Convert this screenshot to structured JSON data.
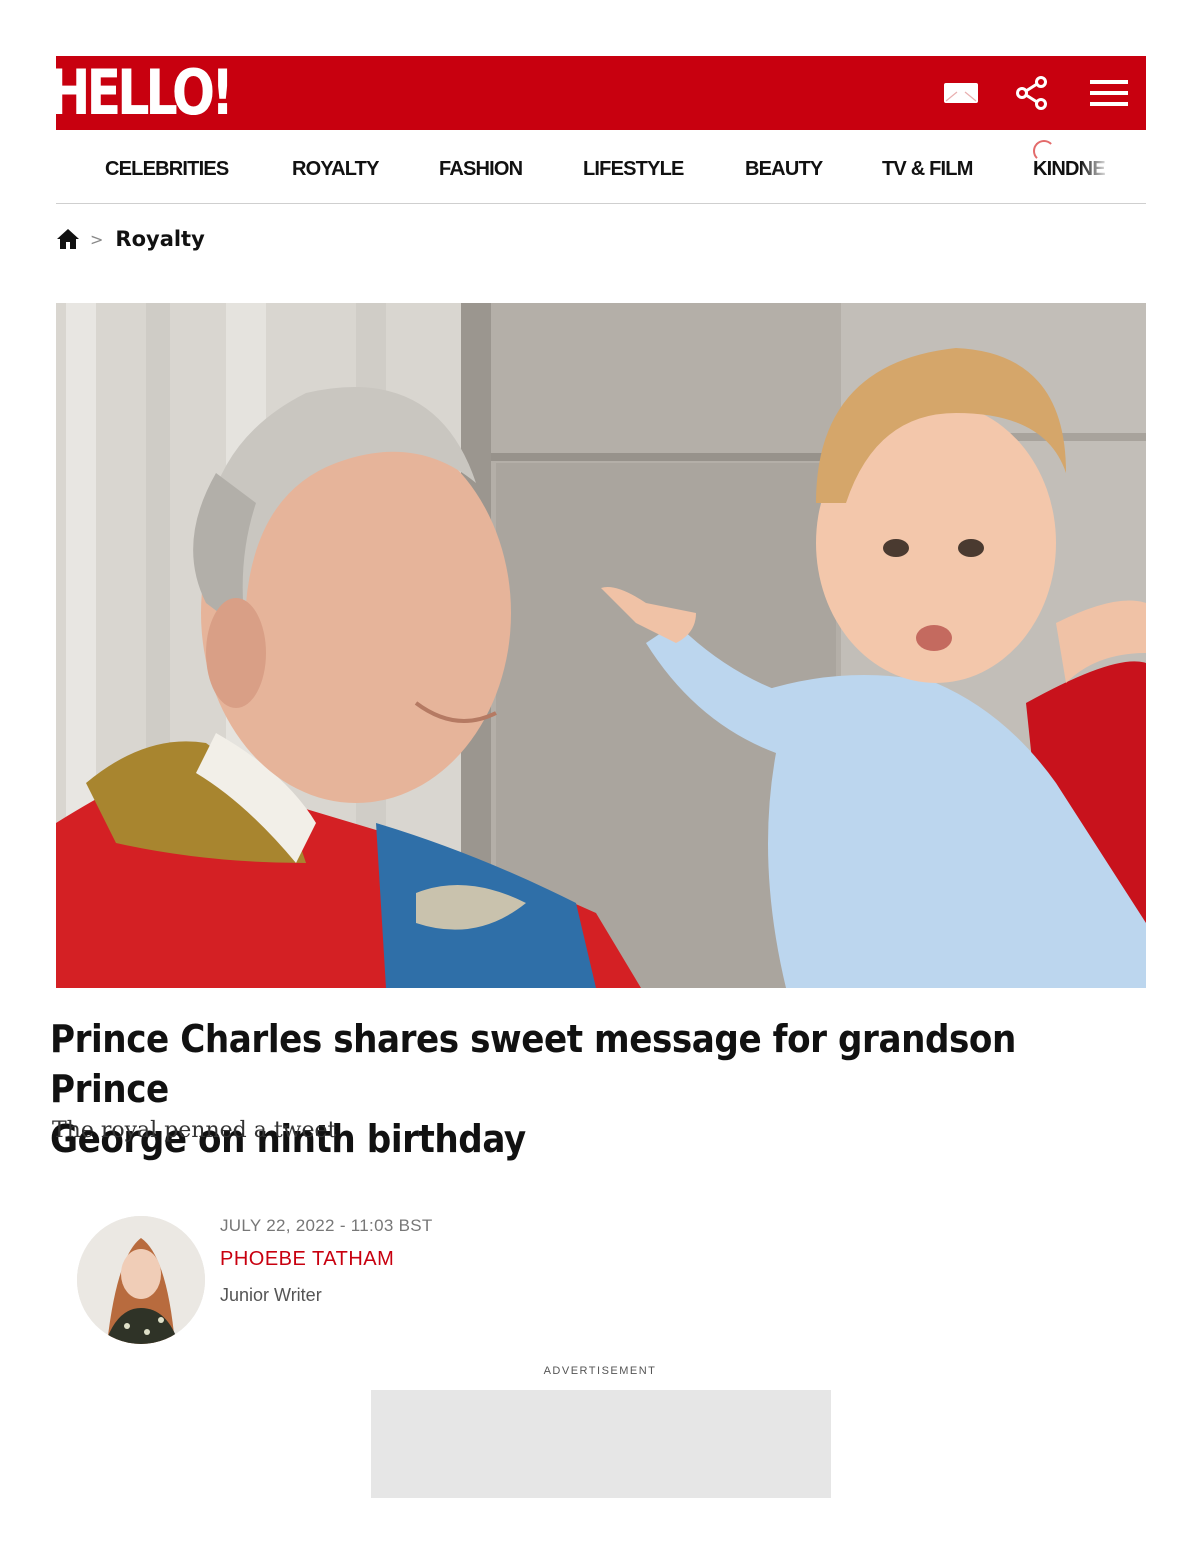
{
  "header": {
    "logo": "HELLO!",
    "icons": [
      "newsletter-icon",
      "share-icon",
      "menu-icon"
    ],
    "brand_color": "#c8000f"
  },
  "nav": {
    "items": [
      "CELEBRITIES",
      "ROYALTY",
      "FASHION",
      "LIFESTYLE",
      "BEAUTY",
      "TV & FILM",
      "KINDNE"
    ]
  },
  "breadcrumb": {
    "home_icon": "home-icon",
    "separator": ">",
    "current": "Royalty"
  },
  "article": {
    "headline_line1": "Prince Charles shares sweet message for grandson Prince",
    "headline_line2": "George on ninth birthday",
    "subheadline": "The royal penned a tweet",
    "date": "JULY 22, 2022 - 11:03 BST",
    "author": "PHOEBE TATHAM",
    "author_role": "Junior Writer"
  },
  "advertisement": {
    "label": "ADVERTISEMENT"
  }
}
